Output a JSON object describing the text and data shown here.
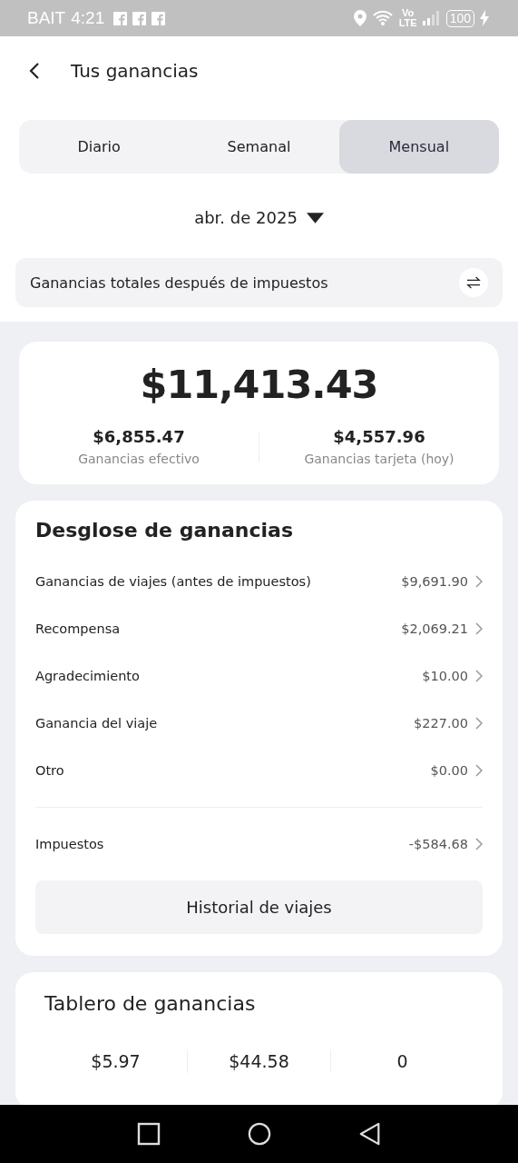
{
  "status_bar": {
    "carrier": "BAIT",
    "time": "4:21",
    "volte_top": "Vo",
    "volte_bottom": "LTE",
    "battery": "100"
  },
  "header": {
    "title": "Tus ganancias"
  },
  "tabs": [
    {
      "label": "Diario",
      "selected": false
    },
    {
      "label": "Semanal",
      "selected": false
    },
    {
      "label": "Mensual",
      "selected": true
    }
  ],
  "period": {
    "label": "abr. de 2025"
  },
  "summary_bar": {
    "label": "Ganancias totales después de impuestos"
  },
  "totals": {
    "total": "$11,413.43",
    "parts": [
      {
        "amount": "$6,855.47",
        "label": "Ganancias efectivo"
      },
      {
        "amount": "$4,557.96",
        "label": "Ganancias tarjeta (hoy)"
      }
    ]
  },
  "breakdown": {
    "title": "Desglose de ganancias",
    "rows": [
      {
        "label": "Ganancias de viajes (antes de impuestos)",
        "amount": "$9,691.90"
      },
      {
        "label": "Recompensa",
        "amount": "$2,069.21"
      },
      {
        "label": "Agradecimiento",
        "amount": "$10.00"
      },
      {
        "label": "Ganancia del viaje",
        "amount": "$227.00"
      },
      {
        "label": "Otro",
        "amount": "$0.00"
      }
    ],
    "tax_row": {
      "label": "Impuestos",
      "amount": "-$584.68"
    },
    "button": "Historial de viajes"
  },
  "dashboard": {
    "title": "Tablero de ganancias",
    "stats": [
      "$5.97",
      "$44.58",
      "0"
    ]
  }
}
